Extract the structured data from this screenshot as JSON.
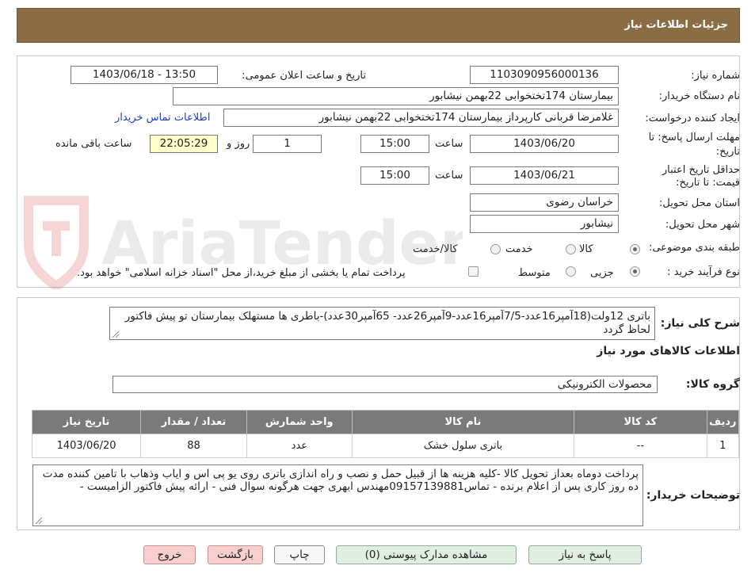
{
  "header": {
    "title": "جزئیات اطلاعات نیاز"
  },
  "need": {
    "number_label": "شماره نیاز:",
    "number_value": "1103090956000136",
    "announce_label": "تاریخ و ساعت اعلان عمومی:",
    "announce_value": "1403/06/18 - 13:50",
    "buyer_label": "نام دستگاه خریدار:",
    "buyer_value": "بیمارستان 174تختخوابی 22بهمن نیشابور",
    "creator_label": "ایجاد کننده درخواست:",
    "creator_value": "غلامرضا قربانی کارپرداز بیمارستان 174تختخوابی 22بهمن نیشابور",
    "contact_link": "اطلاعات تماس خریدار",
    "deadline_label": "مهلت ارسال پاسخ: تا تاریخ:",
    "deadline_date": "1403/06/20",
    "time_label": "ساعت",
    "deadline_time": "15:00",
    "days_value": "1",
    "days_label": "روز و",
    "remaining_value": "22:05:29",
    "remaining_label": "ساعت باقی مانده",
    "validity_label": "حداقل تاریخ اعتبار قیمت: تا تاریخ:",
    "validity_date": "1403/06/21",
    "validity_time": "15:00",
    "province_label": "استان محل تحویل:",
    "province_value": "خراسان رضوی",
    "city_label": "شهر محل تحویل:",
    "city_value": "نیشابور",
    "category_label": "طبقه بندی موضوعی:",
    "category_options": [
      "کالا",
      "خدمت",
      "کالا/خدمت"
    ],
    "category_selected": "کالا",
    "process_label": "نوع فرآیند خرید :",
    "process_options": [
      "جزیی",
      "متوسط"
    ],
    "process_selected": "جزیی",
    "payment_note": "پرداخت تمام یا بخشی از مبلغ خرید،از محل \"اسناد خزانه اسلامی\" خواهد بود."
  },
  "summary": {
    "label": "شرح کلی نیاز:",
    "text": "باتری 12ولت(18آمپر16عدد-7/5آمپر16عدد-9آمپر26عدد- 65آمپر30عدد)-باطری ها مستهلک بیمارستان تو پیش فاکتور لحاظ گردد",
    "goods_title": "اطلاعات کالاهای مورد نیاز",
    "group_label": "گروه کالا:",
    "group_value": "محصولات الکترونیکی"
  },
  "table": {
    "headers": [
      "ردیف",
      "کد کالا",
      "نام کالا",
      "واحد شمارش",
      "تعداد / مقدار",
      "تاریخ نیاز"
    ],
    "rows": [
      [
        "1",
        "--",
        "باتری سلول خشک",
        "عدد",
        "88",
        "1403/06/20"
      ]
    ]
  },
  "notes": {
    "label": "توضیحات خریدار:",
    "text": "پرداخت دوماه بعداز تحویل کالا -کلیه هزینه ها از قبیل حمل و نصب و راه اندازی باتری روی یو پی اس و ایاب وذهاب  با تامین کننده مدت ده روز کاری پس از اعلام برنده - تماس09157139881مهندس ابهری جهت هرگونه سوال فنی - ارائه پیش فاکتور الزامیست -"
  },
  "buttons": {
    "reply": "پاسخ به نیاز",
    "attachments": "مشاهده مدارک پیوستی (0)",
    "print": "چاپ",
    "back": "بازگشت",
    "exit": "خروج"
  },
  "watermark": {
    "brand": "AriaTender.neT"
  },
  "colors": {
    "header_bg": "#8a6d45",
    "table_header_bg": "#7a7a7a",
    "link": "#1a3fcc"
  }
}
